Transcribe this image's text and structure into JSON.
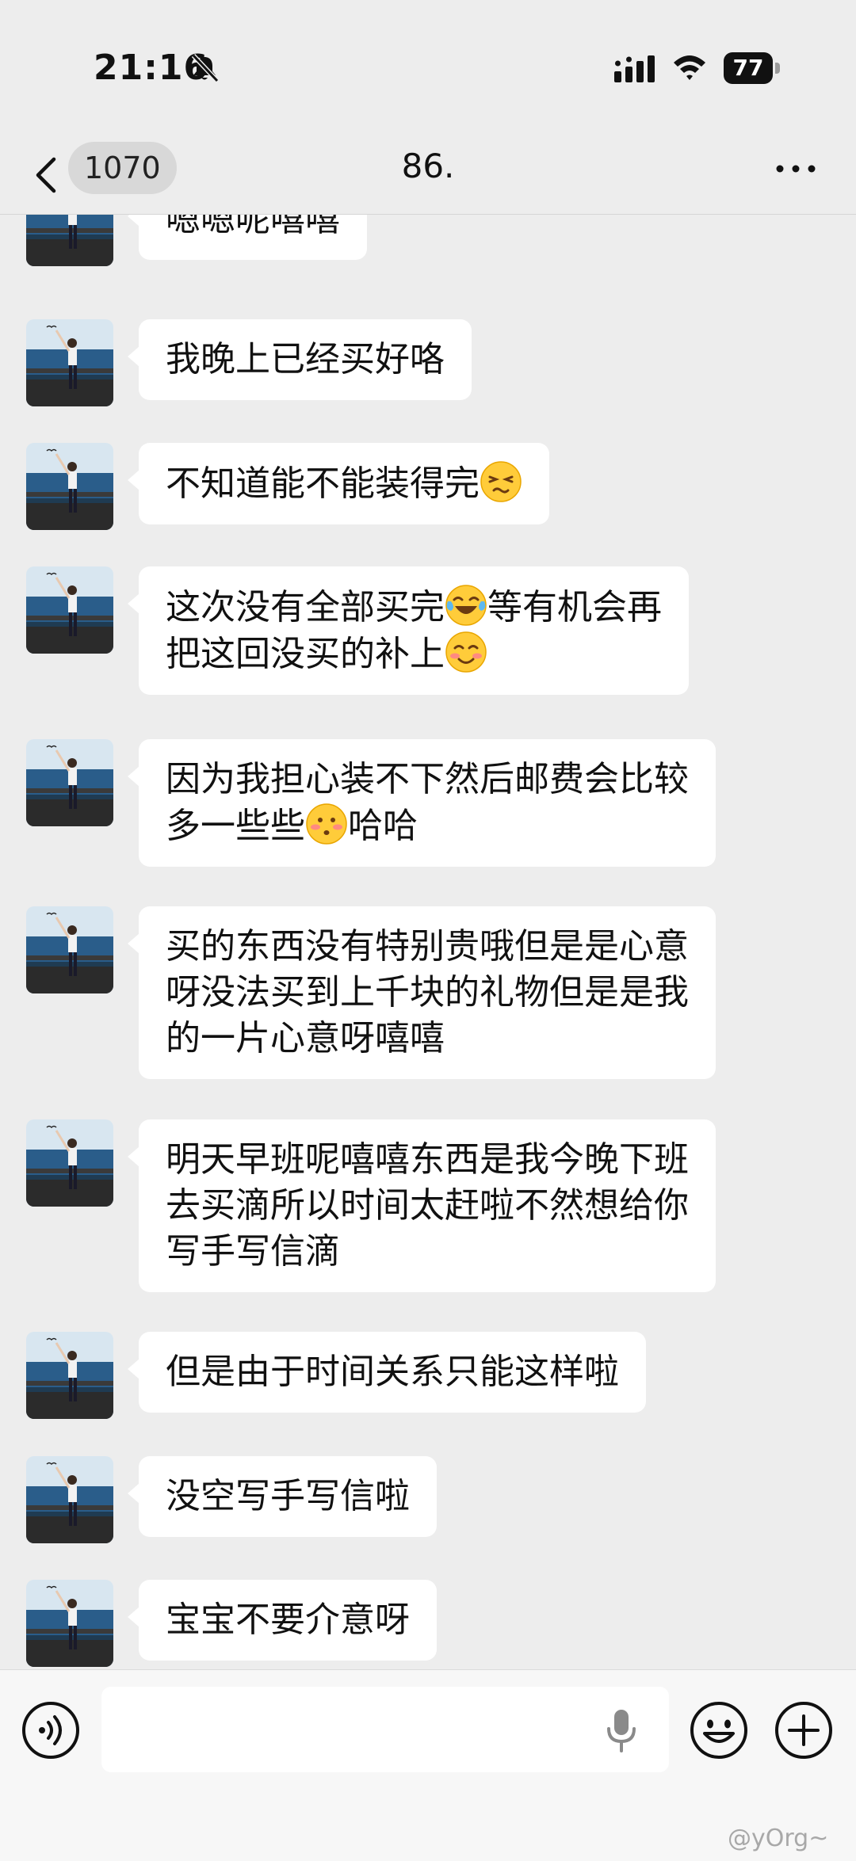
{
  "status_bar": {
    "time": "21:16",
    "battery": "77"
  },
  "nav": {
    "back_count": "1070",
    "title": "86."
  },
  "messages": [
    {
      "text": "嗯嗯呢嘻嘻"
    },
    {
      "text": "我晚上已经买好咯"
    },
    {
      "text": "不知道能不能装得完",
      "emoji_end": "grimace-emoji"
    },
    {
      "line1": "这次没有全部买完",
      "line1_emoji": "laugh-cry-emoji",
      "line1_tail": "等有机会再",
      "line2": "把这回没买的补上",
      "line2_emoji": "blush-emoji"
    },
    {
      "line1": "因为我担心装不下然后邮费会比较",
      "line2": "多一些些",
      "line2_emoji": "flushed-emoji",
      "line2_tail": "哈哈"
    },
    {
      "text": "买的东西没有特别贵哦但是是心意\n呀没法买到上千块的礼物但是是我\n的一片心意呀嘻嘻"
    },
    {
      "text": "明天早班呢嘻嘻东西是我今晚下班\n去买滴所以时间太赶啦不然想给你\n写手写信滴"
    },
    {
      "text": "但是由于时间关系只能这样啦"
    },
    {
      "text": "没空写手写信啦"
    },
    {
      "text": "宝宝不要介意呀"
    }
  ],
  "input": {
    "placeholder": ""
  },
  "watermark": "@yOrg~",
  "colors": {
    "background": "#ededed",
    "bubble": "#ffffff",
    "input_bar": "#f7f7f7"
  }
}
